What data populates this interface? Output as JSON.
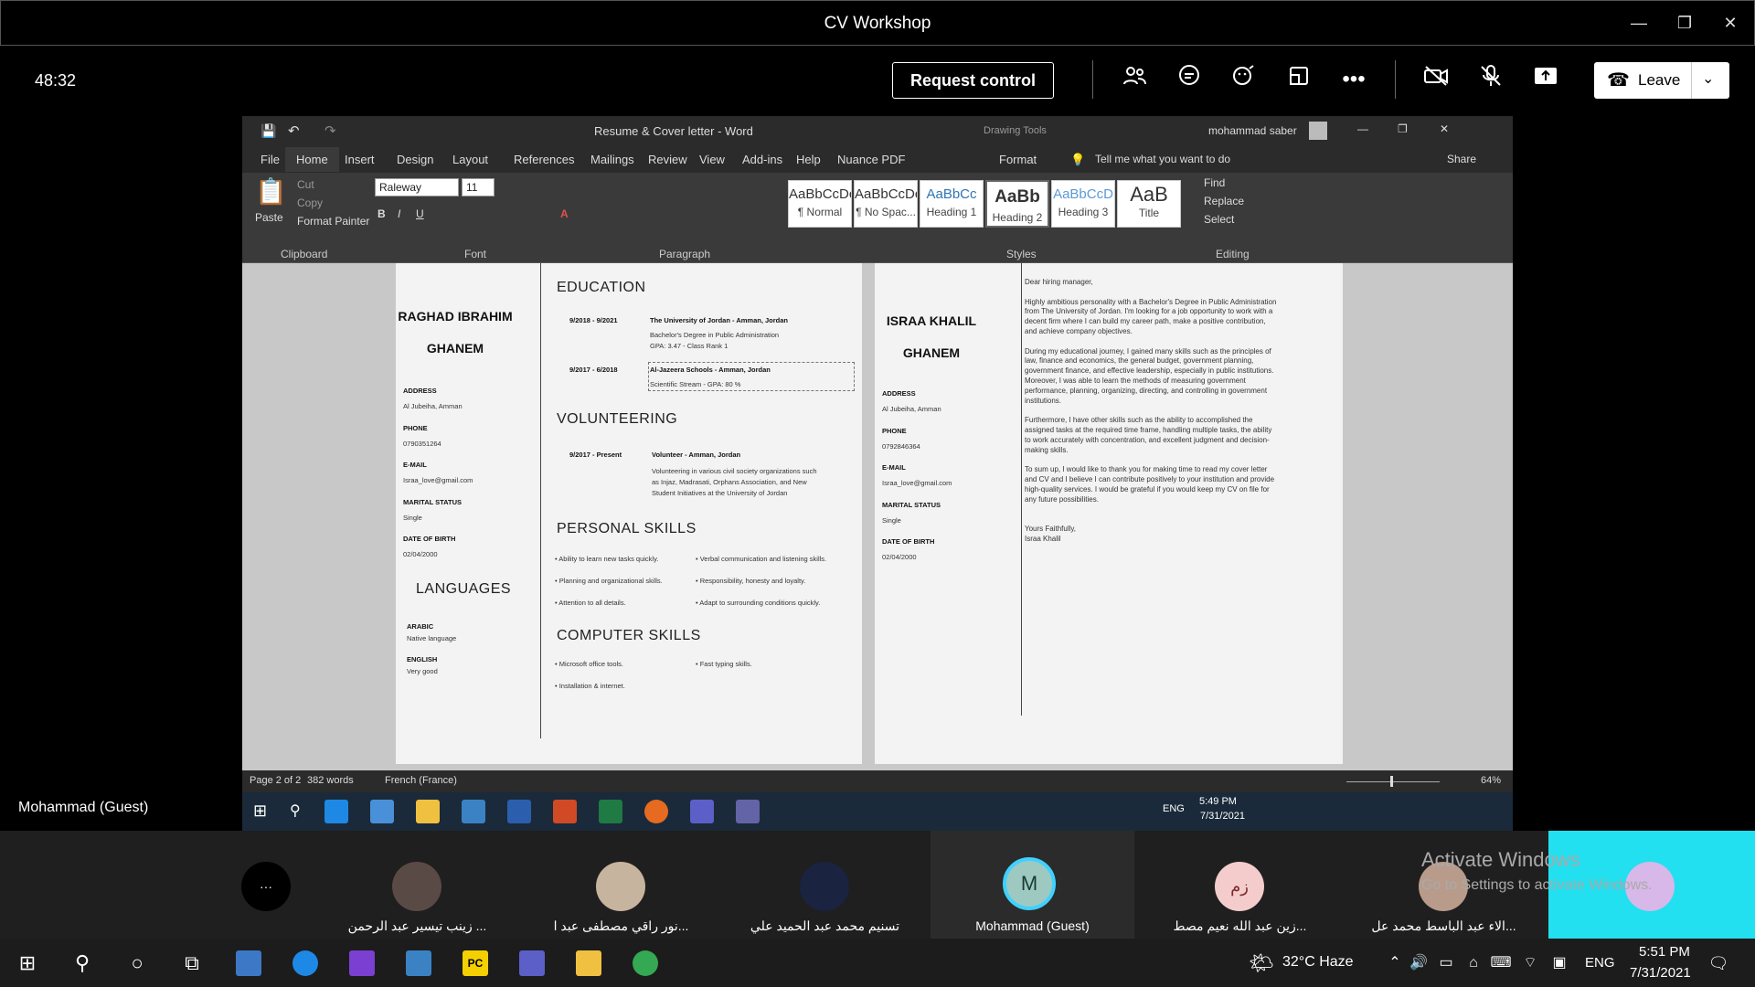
{
  "window": {
    "title": "CV Workshop"
  },
  "meeting": {
    "timer": "48:32",
    "request_control": "Request control",
    "leave": "Leave"
  },
  "word": {
    "title": "Resume & Cover letter - Word",
    "drawing_tools": "Drawing Tools",
    "user": "mohammad saber",
    "tabs": [
      "File",
      "Home",
      "Insert",
      "Design",
      "Layout",
      "References",
      "Mailings",
      "Review",
      "View",
      "Add-ins",
      "Help",
      "Nuance PDF",
      "Format"
    ],
    "tell_me": "Tell me what you want to do",
    "share": "Share",
    "clipboard": {
      "paste": "Paste",
      "cut": "Cut",
      "copy": "Copy",
      "format_painter": "Format Painter",
      "label": "Clipboard"
    },
    "font": {
      "name": "Raleway",
      "size": "11",
      "label": "Font"
    },
    "paragraph_label": "Paragraph",
    "styles": [
      {
        "preview": "AaBbCcDc",
        "name": "¶ Normal"
      },
      {
        "preview": "AaBbCcDc",
        "name": "¶ No Spac..."
      },
      {
        "preview": "AaBbCc",
        "name": "Heading 1"
      },
      {
        "preview": "AaBb",
        "name": "Heading 2"
      },
      {
        "preview": "AaBbCcD",
        "name": "Heading 3"
      },
      {
        "preview": "AaB",
        "name": "Title"
      }
    ],
    "styles_label": "Styles",
    "editing": {
      "find": "Find",
      "replace": "Replace",
      "select": "Select",
      "label": "Editing"
    },
    "status": {
      "page": "Page 2 of 2",
      "words": "382 words",
      "language": "French (France)",
      "zoom": "64%"
    },
    "inner_clock": {
      "time": "5:49 PM",
      "date": "7/31/2021",
      "lang": "ENG"
    }
  },
  "cv1": {
    "name1": "RAGHAD IBRAHIM",
    "name2": "GHANEM",
    "address_label": "ADDRESS",
    "address": "Al Jubeiha, Amman",
    "phone_label": "PHONE",
    "phone": "0790351264",
    "email_label": "E-MAIL",
    "email": "Israa_love@gmail.com",
    "marital_label": "MARITAL STATUS",
    "marital": "Single",
    "dob_label": "DATE OF BIRTH",
    "dob": "02/04/2000",
    "languages": "LANGUAGES",
    "lang1": "ARABIC",
    "lang1_level": "Native language",
    "lang2": "ENGLISH",
    "lang2_level": "Very good",
    "education": "EDUCATION",
    "edu1_date": "9/2018 - 9/2021",
    "edu1_title": "The University of Jordan - Amman, Jordan",
    "edu1_line1": "Bachelor's Degree in Public Administration",
    "edu1_line2": "GPA: 3.47 - Class Rank 1",
    "edu2_date": "9/2017 - 6/2018",
    "edu2_title": "Al-Jazeera Schools - Amman, Jordan",
    "edu2_line1": "Scientific Stream - GPA: 80 %",
    "volunteering": "VOLUNTEERING",
    "vol_date": "9/2017  -  Present",
    "vol_title": "Volunteer - Amman, Jordan",
    "vol_line1": "Volunteering in various civil society organizations such",
    "vol_line2": "as Injaz, Madrasati, Orphans Association, and New",
    "vol_line3": "Student Initiatives at the University of Jordan",
    "personal_skills": "PERSONAL SKILLS",
    "ps1": "• Ability to learn new tasks quickly.",
    "ps2": "• Verbal communication and listening skills.",
    "ps3": "• Planning and organizational skills.",
    "ps4": "• Responsibility, honesty and loyalty.",
    "ps5": "• Attention to all details.",
    "ps6": "• Adapt to surrounding conditions quickly.",
    "computer_skills": "COMPUTER SKILLS",
    "cs1": "• Microsoft office tools.",
    "cs2": "• Fast typing skills.",
    "cs3": "• Installation & internet."
  },
  "cv2": {
    "name1": "ISRAA KHALIL",
    "name2": "GHANEM",
    "address_label": "ADDRESS",
    "address": "Al Jubeiha, Amman",
    "phone_label": "PHONE",
    "phone": "0792846364",
    "email_label": "E-MAIL",
    "email": "Israa_love@gmail.com",
    "marital_label": "MARITAL STATUS",
    "marital": "Single",
    "dob_label": "DATE OF BIRTH",
    "dob": "02/04/2000",
    "letter": [
      "Dear hiring manager,",
      "",
      "Highly ambitious personality with a Bachelor's Degree in Public Administration",
      "from The University of Jordan. I'm looking for a job opportunity to work with a",
      "decent firm where I can build my career path, make a positive contribution,",
      "and achieve company objectives.",
      "",
      "During my educational journey, I gained many skills such as the principles of",
      "law, finance and economics, the general budget, government planning,",
      "government finance, and effective leadership, especially in public institutions.",
      "Moreover, I was able to learn the methods of measuring government",
      "performance, planning, organizing, directing, and controlling in government",
      "institutions.",
      "",
      "Furthermore, I have other skills such as the ability to accomplished the",
      "assigned tasks at the required time frame, handling multiple tasks, the ability",
      "to work accurately with concentration, and excellent judgment and decision-",
      "making skills.",
      "",
      "To sum up, I would like to thank you for making time to read my cover letter",
      "and CV and I believe I can contribute positively to your institution and provide",
      "high-quality services. I would be grateful if you would keep my CV on file for",
      "any future possibilities.",
      "",
      "",
      "Yours Faithfully,",
      "Israa Khalil"
    ]
  },
  "guest_label": "Mohammad (Guest)",
  "participants": [
    {
      "name": "",
      "initials": "···"
    },
    {
      "name": "زينب تيسير عبد الرحمن ...",
      "initials": ""
    },
    {
      "name": "نور راقي مصطفى عبد ا...",
      "initials": ""
    },
    {
      "name": "تسنيم محمد عبد الحميد علي",
      "initials": ""
    },
    {
      "name": "Mohammad (Guest)",
      "initials": "M"
    },
    {
      "name": "زين عبد الله نعيم مصط...",
      "initials": "زم"
    },
    {
      "name": "الاء عبد الباسط محمد عل...",
      "initials": ""
    }
  ],
  "activate": {
    "line1": "Activate Windows",
    "line2": "Go to Settings to activate Windows."
  },
  "taskbar": {
    "weather": "32°C  Haze",
    "lang": "ENG",
    "time": "5:51 PM",
    "date": "7/31/2021"
  }
}
